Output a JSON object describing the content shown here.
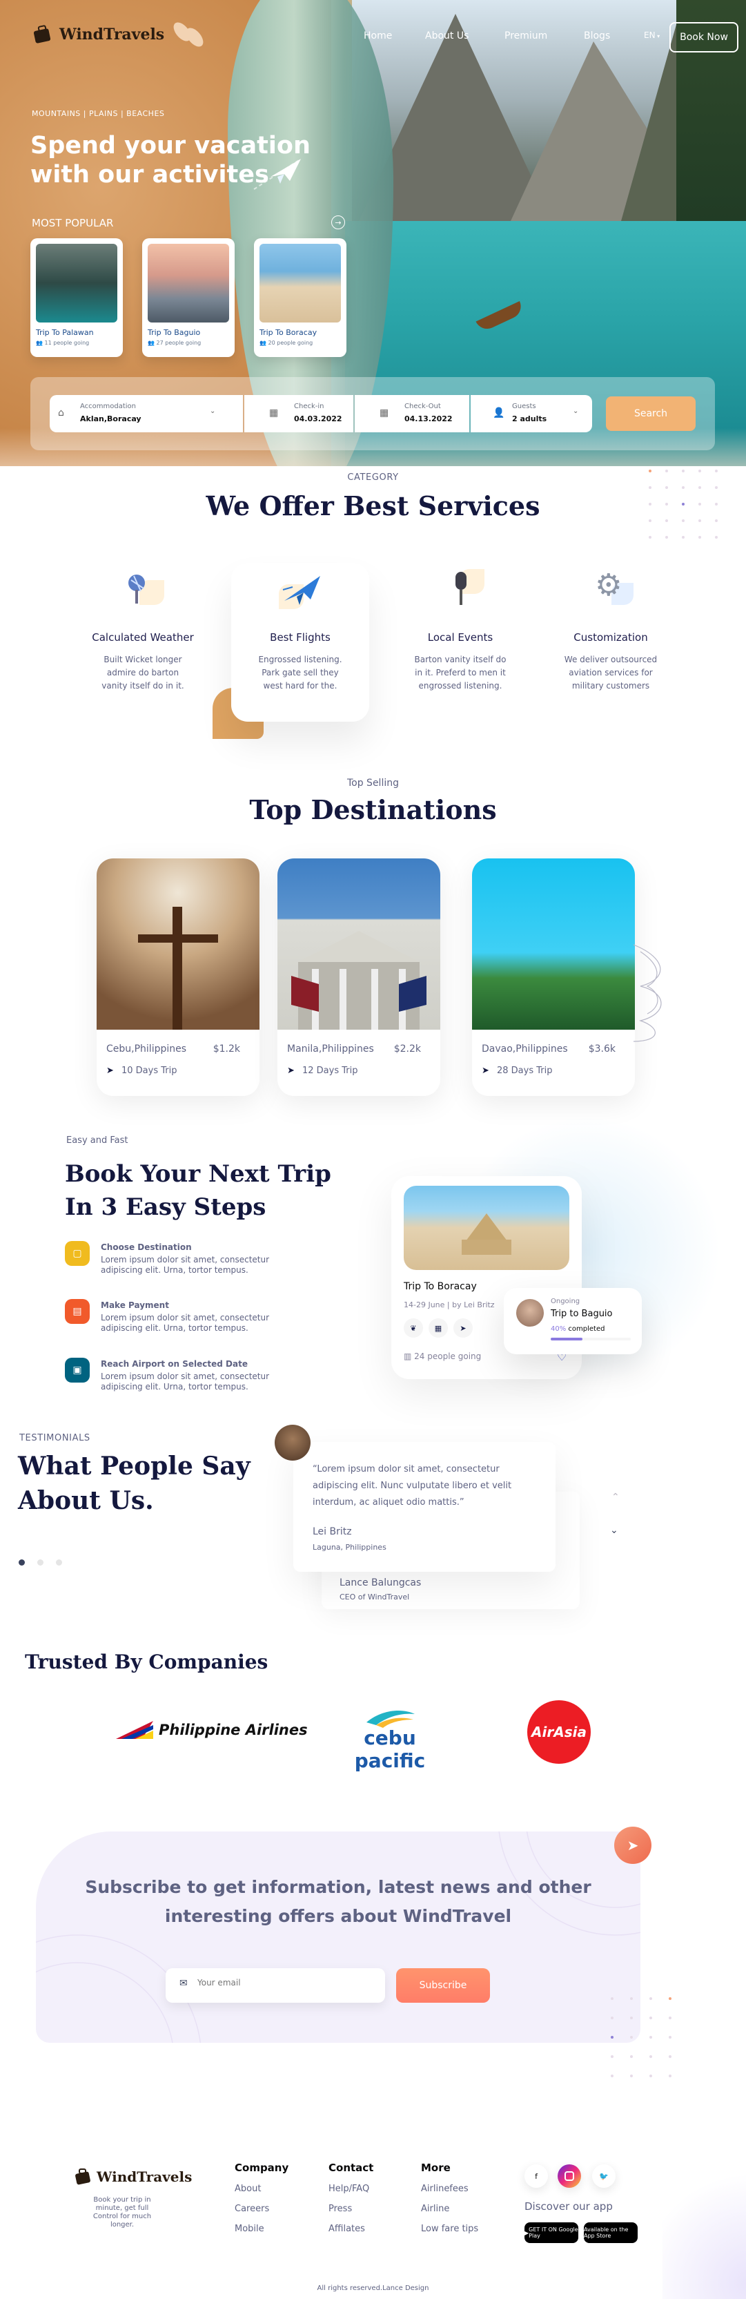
{
  "brand": {
    "logo_text": "WindTravels"
  },
  "nav": {
    "home": "Home",
    "about": "About Us",
    "premium": "Premium",
    "blogs": "Blogs",
    "lang": "EN",
    "book_now": "Book Now"
  },
  "hero": {
    "breadcrumbs": "MOUNTAINS  |  PLAINS  |  BEACHES",
    "title_line1": "Spend your vacation",
    "title_line2": "with our activites",
    "most_popular": "MOST POPULAR",
    "cards": [
      {
        "title": "Trip To Palawan",
        "going": "11 people going"
      },
      {
        "title": "Trip To Baguio",
        "going": "27 people going"
      },
      {
        "title": "Trip To Boracay",
        "going": "20 people going"
      }
    ]
  },
  "search": {
    "accommodation_label": "Accommodation",
    "accommodation_value": "Aklan,Boracay",
    "checkin_label": "Check-in",
    "checkin_value": "04.03.2022",
    "checkout_label": "Check-Out",
    "checkout_value": "04.13.2022",
    "guests_label": "Guests",
    "guests_value": "2 adults",
    "button": "Search"
  },
  "services": {
    "eyebrow": "CATEGORY",
    "title": "We Offer Best Services",
    "items": [
      {
        "title": "Calculated Weather",
        "desc1": "Built Wicket longer",
        "desc2": "admire do barton",
        "desc3": "vanity itself do in it."
      },
      {
        "title": "Best Flights",
        "desc1": "Engrossed listening.",
        "desc2": "Park gate sell they",
        "desc3": "west hard for the."
      },
      {
        "title": "Local Events",
        "desc1": "Barton vanity itself do",
        "desc2": "in it. Preferd to men it",
        "desc3": "engrossed listening."
      },
      {
        "title": "Customization",
        "desc1": "We deliver outsourced",
        "desc2": "aviation services for",
        "desc3": "military customers"
      }
    ]
  },
  "destinations": {
    "eyebrow": "Top Selling",
    "title": "Top Destinations",
    "items": [
      {
        "city": "Cebu,Philippines",
        "price": "$1.2k",
        "days": "10 Days Trip"
      },
      {
        "city": "Manila,Philippines",
        "price": "$2.2k",
        "days": "12 Days Trip"
      },
      {
        "city": "Davao,Philippines",
        "price": "$3.6k",
        "days": "28 Days Trip"
      }
    ]
  },
  "steps": {
    "eyebrow": "Easy and Fast",
    "title_line1": "Book Your Next Trip",
    "title_line2": "In 3 Easy Steps",
    "items": [
      {
        "title": "Choose Destination",
        "desc1": "Lorem ipsum dolor sit amet, consectetur",
        "desc2": "adipiscing elit. Urna, tortor tempus.",
        "color": "#f0bb1f"
      },
      {
        "title": "Make Payment",
        "desc1": "Lorem ipsum dolor sit amet, consectetur",
        "desc2": "adipiscing elit. Urna, tortor tempus.",
        "color": "#f15a2b"
      },
      {
        "title": "Reach Airport on Selected Date",
        "desc1": "Lorem ipsum dolor sit amet, consectetur",
        "desc2": "adipiscing elit. Urna, tortor tempus.",
        "color": "#006380"
      }
    ],
    "trip_card": {
      "title": "Trip To Boracay",
      "dates": "14-29 June",
      "by": "by Lei Britz",
      "going": "24 people going"
    },
    "ongoing": {
      "label": "Ongoing",
      "title": "Trip to Baguio",
      "pct": "40%",
      "completed": "completed",
      "progress": 0.4
    }
  },
  "testimonials": {
    "eyebrow": "TESTIMONIALS",
    "title_line1": "What People Say",
    "title_line2": "About Us.",
    "quote1": "“Lorem ipsum dolor sit amet, consectetur",
    "quote2": "adipiscing elit. Nunc vulputate libero et velit",
    "quote3": "interdum, ac aliquet odio mattis.”",
    "name": "Lei Britz",
    "location": "Laguna, Philippines",
    "back_name": "Lance Balungcas",
    "back_role": "CEO of WindTravel"
  },
  "trusted": {
    "title": "Trusted By Companies",
    "pal": "Philippine Airlines",
    "cebu": "cebu pacific",
    "airasia": "AirAsia"
  },
  "subscribe": {
    "line1": "Subscribe to get information, latest news and other",
    "line2": "interesting offers about WindTravel",
    "placeholder": "Your email",
    "button": "Subscribe"
  },
  "footer": {
    "logo_text": "WindTravels",
    "tagline1": "Book your trip in minute, get full",
    "tagline2": "Control for much longer.",
    "company": {
      "h": "Company",
      "l1": "About",
      "l2": "Careers",
      "l3": "Mobile"
    },
    "contact": {
      "h": "Contact",
      "l1": "Help/FAQ",
      "l2": "Press",
      "l3": "Affilates"
    },
    "more": {
      "h": "More",
      "l1": "Airlinefees",
      "l2": "Airline",
      "l3": "Low fare tips"
    },
    "discover": "Discover our app",
    "gplay": "GET IT ON Google Play",
    "appstore": "Available on the App Store",
    "copyright": "All rights reserved.Lance Design"
  }
}
